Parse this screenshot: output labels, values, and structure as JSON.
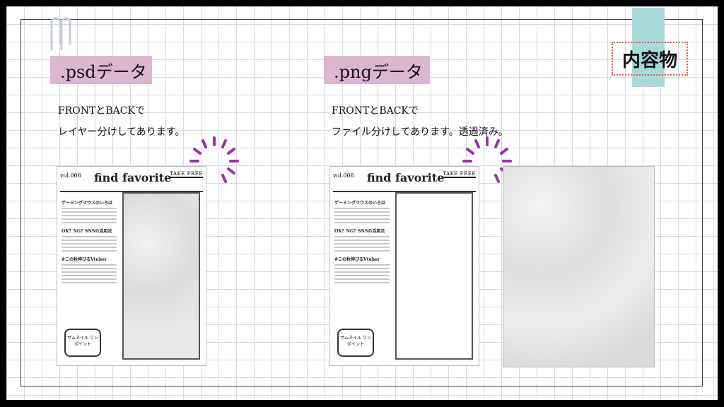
{
  "badge": {
    "label": "内容物"
  },
  "left": {
    "title": ".psdデータ",
    "line1": "FRONTとBACKで",
    "line2": "レイヤー分けしてあります。",
    "mock": {
      "brand": "find favorite",
      "tag": "TAKE FREE",
      "vol": "vol.006",
      "sec1": "ゲーミングマウスのいろは",
      "sec2": "OK？NG？SNSの活用法",
      "sec3": "#この秋伸びるVtuber",
      "stamp": "サムネイル ワンポイント"
    }
  },
  "right": {
    "title": ".pngデータ",
    "line1": "FRONTとBACKで",
    "line2": "ファイル分けしてあります。透過済み。",
    "mock": {
      "brand": "find favorite",
      "tag": "TAKE FREE",
      "vol": "vol.006",
      "sec1": "ゲーミングマウスのいろは",
      "sec2": "OK？NG？SNSの活用法",
      "sec3": "#この秋伸びるVtuber",
      "stamp": "サムネイル ワンポイント"
    }
  },
  "colors": {
    "title_bg": "#dcb6cf",
    "tab": "#a8d9d9",
    "burst": "#9b2fae",
    "dot_border": "#e5573a"
  }
}
